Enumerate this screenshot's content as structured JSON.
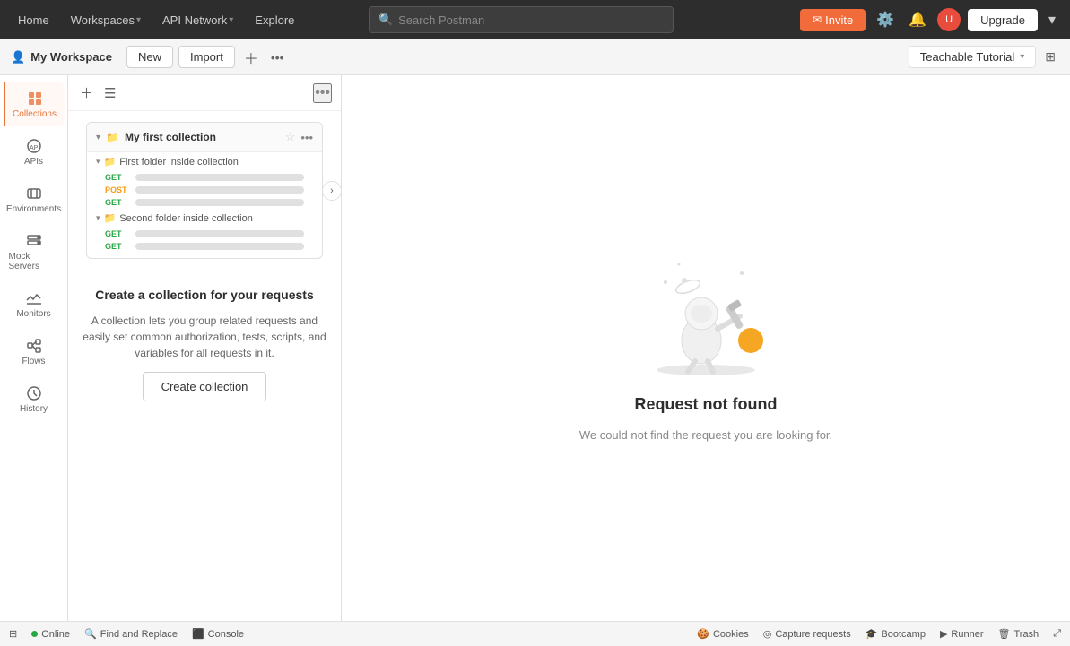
{
  "topnav": {
    "home": "Home",
    "workspaces": "Workspaces",
    "api_network": "API Network",
    "explore": "Explore",
    "search_placeholder": "Search Postman",
    "invite_label": "Invite",
    "upgrade_label": "Upgrade"
  },
  "workspacebar": {
    "user_icon": "👤",
    "workspace_name": "My Workspace",
    "new_label": "New",
    "import_label": "Import",
    "teachable_tab": "Teachable Tutorial"
  },
  "sidebar": {
    "items": [
      {
        "id": "collections",
        "label": "Collections",
        "icon": "collections"
      },
      {
        "id": "apis",
        "label": "APIs",
        "icon": "apis"
      },
      {
        "id": "environments",
        "label": "Environments",
        "icon": "environments"
      },
      {
        "id": "mock-servers",
        "label": "Mock Servers",
        "icon": "mock-servers"
      },
      {
        "id": "monitors",
        "label": "Monitors",
        "icon": "monitors"
      },
      {
        "id": "flows",
        "label": "Flows",
        "icon": "flows"
      },
      {
        "id": "history",
        "label": "History",
        "icon": "history"
      }
    ]
  },
  "collections_panel": {
    "collection_name": "My first collection",
    "folder1_name": "First folder inside collection",
    "folder2_name": "Second folder inside collection",
    "requests_folder1": [
      {
        "method": "GET"
      },
      {
        "method": "POST"
      },
      {
        "method": "GET"
      }
    ],
    "requests_folder2": [
      {
        "method": "GET"
      },
      {
        "method": "GET"
      }
    ]
  },
  "create_section": {
    "title": "Create a collection for your requests",
    "description": "A collection lets you group related requests and easily set common authorization, tests, scripts, and variables for all requests in it.",
    "button_label": "Create collection"
  },
  "main_content": {
    "title": "Request not found",
    "subtitle": "We could not find the request you are looking for."
  },
  "bottom_bar": {
    "status": "Online",
    "find_replace": "Find and Replace",
    "console": "Console",
    "cookies": "Cookies",
    "capture_requests": "Capture requests",
    "bootcamp": "Bootcamp",
    "runner": "Runner",
    "trash": "Trash"
  }
}
